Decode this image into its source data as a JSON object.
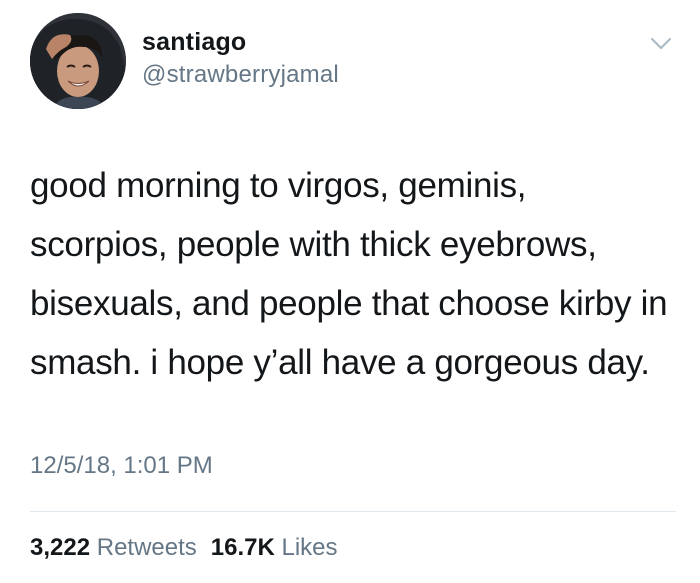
{
  "user": {
    "display_name": "santiago",
    "handle": "@strawberryjamal",
    "avatar_icon": "profile-photo"
  },
  "menu": {
    "icon": "chevron-down-icon"
  },
  "tweet": {
    "text": "good morning to virgos, geminis, scorpios, people with thick eyebrows, bisexuals, and people that choose kirby in smash. i hope y’all have a gorgeous day.",
    "timestamp": "12/5/18, 1:01 PM"
  },
  "stats": {
    "retweets_count": "3,222",
    "retweets_label": "Retweets",
    "likes_count": "16.7K",
    "likes_label": "Likes"
  },
  "colors": {
    "text": "#14171a",
    "secondary": "#657786",
    "divider": "#e1e8ed",
    "background": "#ffffff"
  }
}
